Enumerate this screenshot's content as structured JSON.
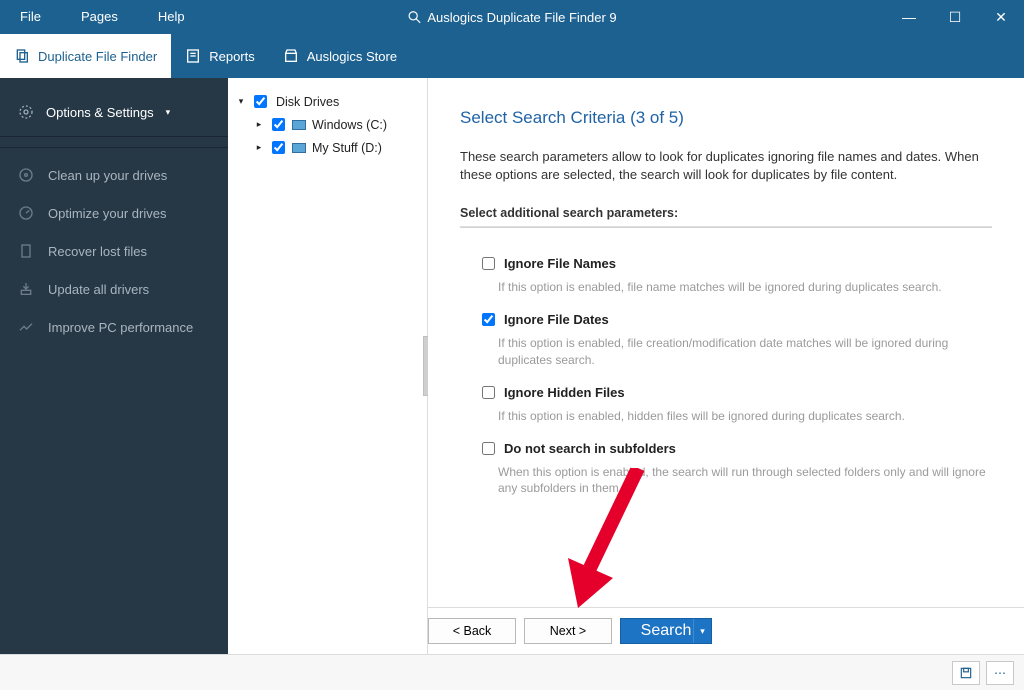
{
  "title": "Auslogics Duplicate File Finder 9",
  "menu": {
    "file": "File",
    "pages": "Pages",
    "help": "Help"
  },
  "tabs": {
    "finder": "Duplicate File Finder",
    "reports": "Reports",
    "store": "Auslogics Store"
  },
  "sidebar": {
    "options": "Options & Settings",
    "items": [
      "Clean up your drives",
      "Optimize your drives",
      "Recover lost files",
      "Update all drivers",
      "Improve PC performance"
    ]
  },
  "tree": {
    "root": "Disk Drives",
    "drives": [
      {
        "label": "Windows (C:)"
      },
      {
        "label": "My Stuff (D:)"
      }
    ]
  },
  "wizard": {
    "heading": "Select Search Criteria (3 of 5)",
    "desc": "These search parameters allow to look for duplicates ignoring file names and dates. When these options are selected, the search will look for duplicates by file content.",
    "subhead": "Select additional search parameters:",
    "options": [
      {
        "label": "Ignore File Names",
        "checked": false,
        "help": "If this option is enabled, file name matches will be ignored during duplicates search."
      },
      {
        "label": "Ignore File Dates",
        "checked": true,
        "help": "If this option is enabled, file creation/modification date matches will be ignored during duplicates search."
      },
      {
        "label": "Ignore Hidden Files",
        "checked": false,
        "help": "If this option is enabled, hidden files will be ignored during duplicates search."
      },
      {
        "label": "Do not search in subfolders",
        "checked": false,
        "help": "When this option is enabled, the search will run through selected folders only and will ignore any subfolders in them"
      }
    ],
    "back": "< Back",
    "next": "Next >",
    "search": "Search"
  }
}
